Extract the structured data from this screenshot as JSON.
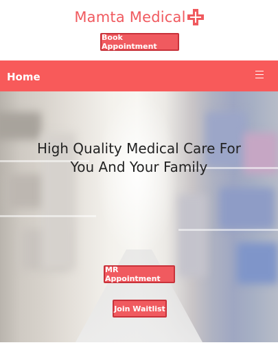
{
  "header": {
    "brand_name": "Mamta Medical",
    "book_label": "Book Appointment"
  },
  "navbar": {
    "home_label": "Home",
    "menu_icon": "hamburger-menu-icon"
  },
  "hero": {
    "title": "High Quality Medical Care For You And Your Family",
    "mr_label": "MR Appointment",
    "waitlist_label": "Join Waitlist"
  },
  "colors": {
    "brand": "#f05a5f",
    "navbar": "#f85a5a",
    "button_border": "#c8323a"
  }
}
